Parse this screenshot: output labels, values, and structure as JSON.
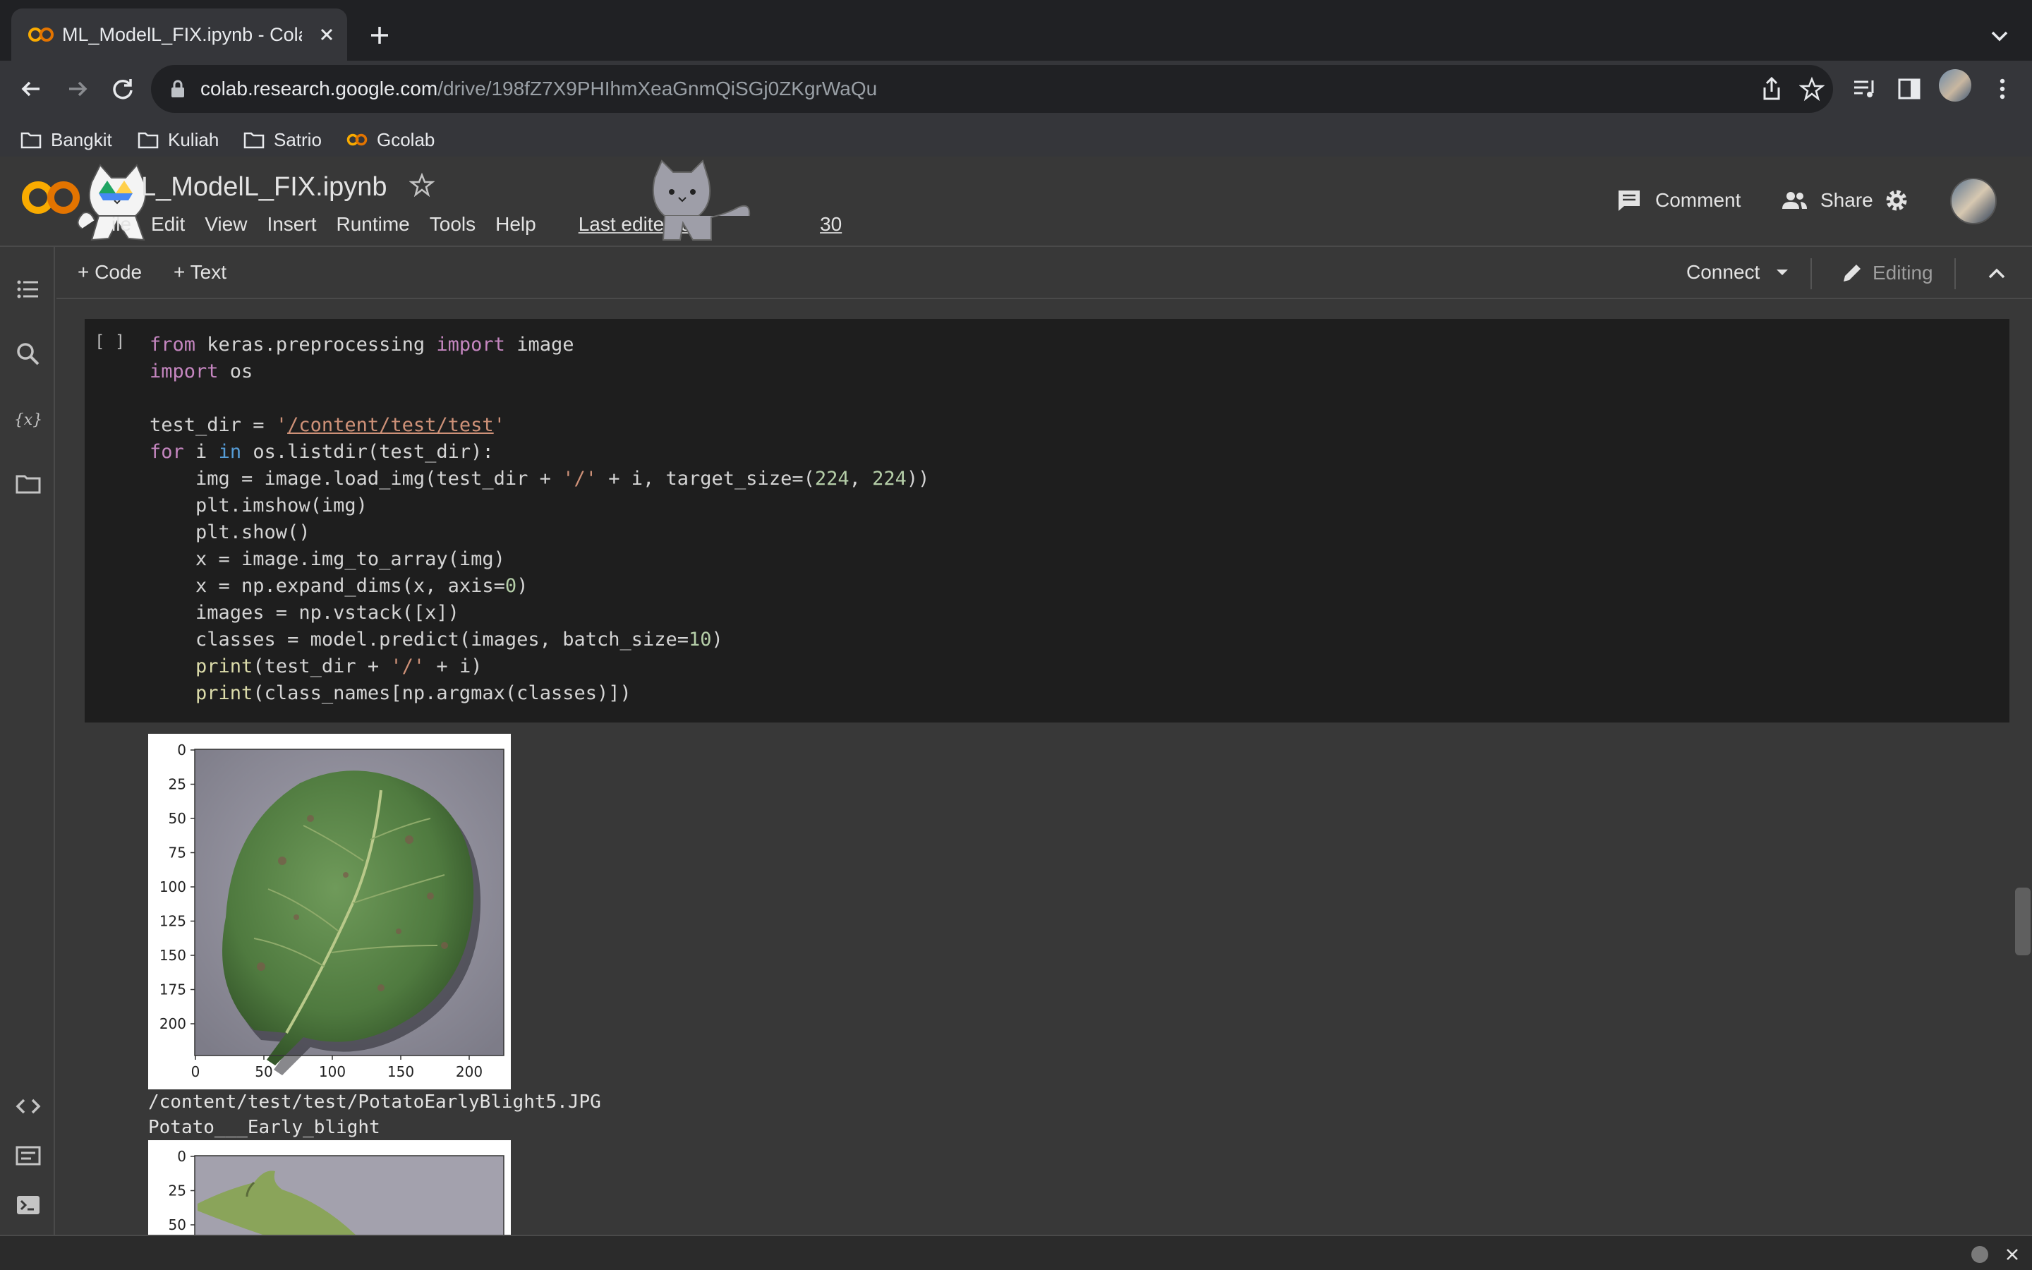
{
  "browser": {
    "tab_title": "ML_ModelL_FIX.ipynb - Colab",
    "url_host": "colab.research.google.com",
    "url_path": "/drive/198fZ7X9PHIhmXeaGnmQiSGj0ZKgrWaQu",
    "bookmarks": [
      {
        "label": "Bangkit",
        "icon": "folder-icon"
      },
      {
        "label": "Kuliah",
        "icon": "folder-icon"
      },
      {
        "label": "Satrio",
        "icon": "folder-icon"
      },
      {
        "label": "Gcolab",
        "icon": "colab-icon"
      }
    ]
  },
  "header": {
    "title": "ML_ModelL_FIX.ipynb",
    "title_visible": "L_ModelL_FIX.ipynb",
    "menu": [
      "File",
      "Edit",
      "View",
      "Insert",
      "Runtime",
      "Tools",
      "Help"
    ],
    "menu_visible_file": "ile",
    "last_edited": "Last edited o",
    "last_edited_tail": "30",
    "comment_label": "Comment",
    "share_label": "Share"
  },
  "toolbar": {
    "code_label": "+ Code",
    "text_label": "+ Text",
    "connect_label": "Connect",
    "editing_label": "Editing"
  },
  "cell": {
    "run_indicator": "[ ]"
  },
  "output": {
    "plots": [
      {
        "y_ticks": [
          "0",
          "25",
          "50",
          "75",
          "100",
          "125",
          "150",
          "175",
          "200"
        ],
        "x_ticks": [
          "0",
          "50",
          "100",
          "150",
          "200"
        ],
        "path_line": "/content/test/test/PotatoEarlyBlight5.JPG",
        "class_line": "Potato___Early_blight"
      },
      {
        "y_ticks": [
          "0",
          "25",
          "50"
        ]
      }
    ]
  },
  "colors": {
    "accent_orange": "#f9ab00",
    "keyword": "#c586c0",
    "string": "#ce9178",
    "number": "#b5cea8"
  }
}
